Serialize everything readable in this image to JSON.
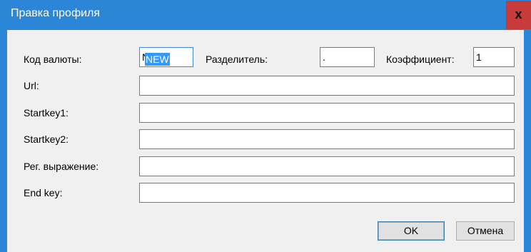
{
  "window": {
    "title": "Правка профиля",
    "close_glyph": "x"
  },
  "form": {
    "currency_code": {
      "label": "Код валюты:",
      "value": "NEW"
    },
    "separator": {
      "label": "Разделитель:",
      "value": "."
    },
    "coefficient": {
      "label": "Коэффициент:",
      "value": "1"
    },
    "url": {
      "label": "Url:",
      "value": ""
    },
    "startkey1": {
      "label": "Startkey1:",
      "value": ""
    },
    "startkey2": {
      "label": "Startkey2:",
      "value": ""
    },
    "regex": {
      "label": "Рег. выражение:",
      "value": ""
    },
    "endkey": {
      "label": "End key:",
      "value": ""
    }
  },
  "buttons": {
    "ok_label": "OK",
    "cancel_label": "Отмена"
  },
  "colors": {
    "titlebar": "#2b86d8",
    "close_button": "#c73b3b",
    "selection": "#3399ff",
    "client_background": "#f0f0f0"
  }
}
